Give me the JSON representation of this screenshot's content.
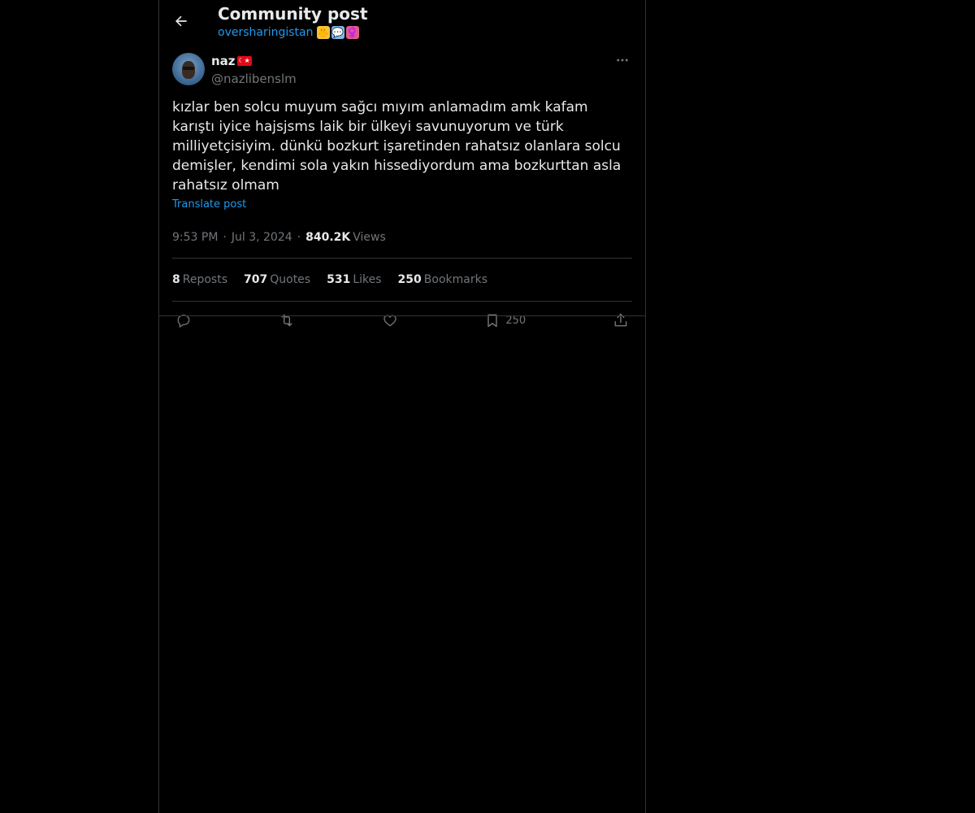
{
  "header": {
    "title": "Community post",
    "community": "oversharingistan",
    "emojis": [
      "🐥",
      "💬",
      "♀️"
    ]
  },
  "author": {
    "name": "naz",
    "flag": "☾★",
    "handle": "@nazlibenslm"
  },
  "post": {
    "text": "kızlar ben solcu muyum sağcı mıyım anlamadım amk kafam karıştı iyice hajsjsms laik bir ülkeyi savunuyorum ve türk milliyetçisiyim. dünkü bozkurt işaretinden rahatsız olanlara solcu demişler, kendimi sola yakın hissediyordum ama bozkurttan asla rahatsız olmam",
    "translate_label": "Translate post"
  },
  "meta": {
    "time": "9:53 PM",
    "date": "Jul 3, 2024",
    "views_count": "840.2K",
    "views_label": "Views"
  },
  "stats": {
    "reposts_count": "8",
    "reposts_label": "Reposts",
    "quotes_count": "707",
    "quotes_label": "Quotes",
    "likes_count": "531",
    "likes_label": "Likes",
    "bookmarks_count": "250",
    "bookmarks_label": "Bookmarks"
  },
  "actions": {
    "bookmark_count": "250"
  },
  "colors": {
    "background": "#000000",
    "accent": "#1d9bf0",
    "text": "#e7e9ea",
    "muted": "#71767b",
    "border": "#2f3336"
  },
  "icons": {
    "back": "arrow-left-icon",
    "more": "more-horizontal-icon",
    "reply": "reply-icon",
    "repost": "repost-icon",
    "like": "heart-icon",
    "bookmark": "bookmark-icon",
    "share": "share-icon"
  }
}
